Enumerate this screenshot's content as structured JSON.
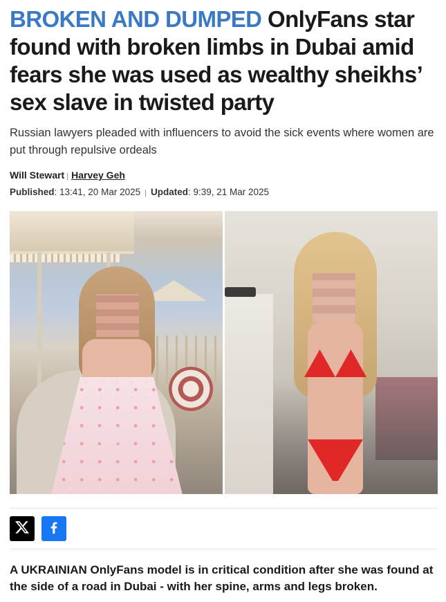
{
  "article": {
    "kicker": "BROKEN AND DUMPED",
    "headline": "OnlyFans star found with broken limbs in Dubai amid fears she was used as wealthy sheikhs’ sex slave in twisted party",
    "standfirst": "Russian lawyers pleaded with influencers to avoid the sick events where women are put through repulsive ordeals",
    "byline": {
      "author_1": "Will Stewart",
      "separator": "|",
      "author_2": "Harvey Geh"
    },
    "dates": {
      "published_label": "Published",
      "published_value": ": 13:41, 20 Mar 2025",
      "separator": "|",
      "updated_label": "Updated",
      "updated_value": ": 9:39, 21 Mar 2025"
    },
    "lede": "A UKRAINIAN OnlyFans model is in critical condition after she was found at the side of a road in Dubai - with her spine, arms and legs broken."
  },
  "share": {
    "icons": [
      "x-icon",
      "facebook-icon"
    ],
    "colors": {
      "x": "#000000",
      "facebook": "#1877f2"
    }
  },
  "colors": {
    "kicker": "#3a79c4",
    "headline": "#1a1a1a"
  }
}
